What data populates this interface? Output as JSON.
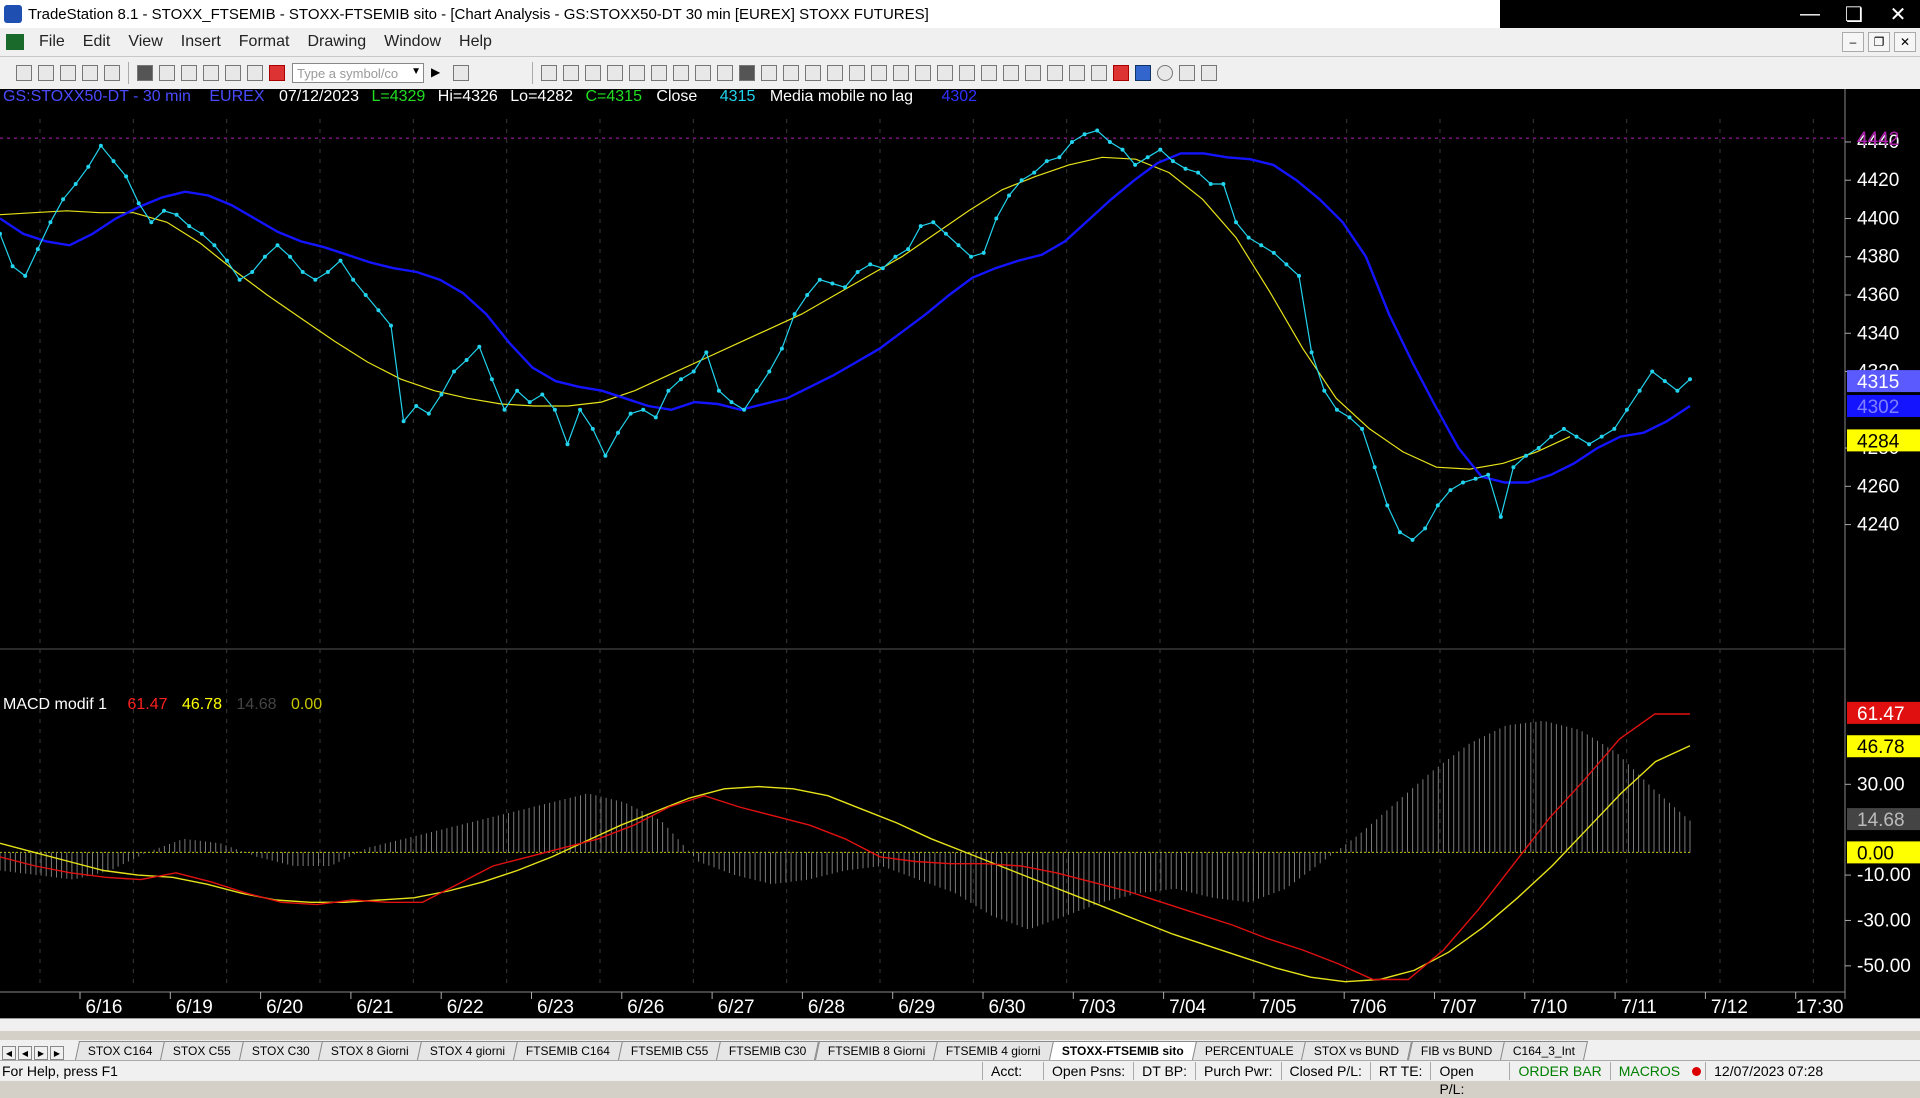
{
  "window": {
    "title": "TradeStation 8.1 - STOXX_FTSEMIB - STOXX-FTSEMIB sito - [Chart Analysis - GS:STOXX50-DT  30 min  [EUREX] STOXX FUTURES]"
  },
  "menu": {
    "items": [
      "File",
      "Edit",
      "View",
      "Insert",
      "Format",
      "Drawing",
      "Window",
      "Help"
    ]
  },
  "toolbar": {
    "symbol_placeholder": "Type a symbol/co"
  },
  "header": {
    "symbol": "GS:STOXX50-DT - 30 min",
    "exchange": "EUREX",
    "date": "07/12/2023",
    "last": "L=4329",
    "high": "Hi=4326",
    "low": "Lo=4282",
    "close": "C=4315",
    "close_label": "Close",
    "close_value": "4315",
    "ma_name": "Media mobile no lag",
    "ma_value": "4302"
  },
  "macd_header": {
    "name": "MACD modif 1",
    "v1": "61.47",
    "v2": "46.78",
    "v3": "14.68",
    "v4": "0.00"
  },
  "colors": {
    "price": "#22d3ee",
    "ma_blue": "#1414ff",
    "ma_yellow": "#e6e21a",
    "macd_red": "#e01010",
    "macd_yellow": "#e6e21a",
    "hist": "#7a7a7a",
    "marker_purple": "#b020b0"
  },
  "chart_data": [
    {
      "type": "line",
      "title": "GS:STOXX50-DT - 30 min",
      "x_labels": [
        "6/16",
        "6/19",
        "6/20",
        "6/21",
        "6/22",
        "6/23",
        "6/26",
        "6/27",
        "6/28",
        "6/29",
        "6/30",
        "7/03",
        "7/04",
        "7/05",
        "7/06",
        "7/07",
        "7/10",
        "7/11",
        "7/12",
        "17:30"
      ],
      "y_ticks": [
        "4440",
        "4420",
        "4400",
        "4380",
        "4360",
        "4340",
        "4320",
        "4280",
        "4260",
        "4240"
      ],
      "ylim": [
        4222,
        4452
      ],
      "price_tags": [
        {
          "value": 4442,
          "label": "4442",
          "color": "#b020b0"
        },
        {
          "value": 4315,
          "label": "4315",
          "color": "#5a5aff"
        },
        {
          "value": 4302,
          "label": "4302",
          "color": "#1414ff"
        },
        {
          "value": 4284,
          "label": "4284",
          "color": "#ffff00"
        }
      ],
      "series": [
        {
          "name": "Close",
          "values": [
            4392,
            4375,
            4370,
            4384,
            4398,
            4410,
            4418,
            4427,
            4438,
            4430,
            4422,
            4408,
            4398,
            4404,
            4402,
            4396,
            4392,
            4386,
            4378,
            4368,
            4372,
            4380,
            4386,
            4380,
            4372,
            4368,
            4372,
            4378,
            4368,
            4360,
            4352,
            4344,
            4294,
            4302,
            4298,
            4308,
            4320,
            4326,
            4333,
            4316,
            4300,
            4310,
            4304,
            4308,
            4300,
            4282,
            4300,
            4290,
            4276,
            4288,
            4298,
            4300,
            4296,
            4310,
            4316,
            4320,
            4330,
            4310,
            4304,
            4300,
            4310,
            4320,
            4332,
            4350,
            4360,
            4368,
            4366,
            4364,
            4372,
            4376,
            4374,
            4380,
            4384,
            4396,
            4398,
            4392,
            4386,
            4380,
            4382,
            4400,
            4412,
            4420,
            4424,
            4430,
            4432,
            4440,
            4444,
            4446,
            4440,
            4436,
            4428,
            4432,
            4436,
            4430,
            4426,
            4424,
            4418,
            4418,
            4398,
            4390,
            4386,
            4382,
            4376,
            4370,
            4330,
            4310,
            4300,
            4296,
            4290,
            4270,
            4250,
            4236,
            4232,
            4238,
            4250,
            4258,
            4262,
            4264,
            4266,
            4244,
            4270,
            4276,
            4280,
            4286,
            4290,
            4286,
            4282,
            4286,
            4290,
            4300,
            4310,
            4320,
            4315,
            4310,
            4316
          ]
        },
        {
          "name": "Media mobile no lag",
          "values": [
            4400,
            4392,
            4388,
            4386,
            4392,
            4400,
            4406,
            4411,
            4414,
            4412,
            4407,
            4400,
            4393,
            4388,
            4385,
            4381,
            4377,
            4374,
            4372,
            4368,
            4361,
            4350,
            4335,
            4322,
            4315,
            4312,
            4310,
            4306,
            4302,
            4300,
            4304,
            4303,
            4300,
            4303,
            4306,
            4312,
            4318,
            4325,
            4332,
            4341,
            4350,
            4360,
            4369,
            4374,
            4378,
            4381,
            4388,
            4399,
            4410,
            4420,
            4429,
            4434,
            4434,
            4432,
            4431,
            4428,
            4420,
            4410,
            4398,
            4380,
            4350,
            4325,
            4302,
            4280,
            4265,
            4262,
            4262,
            4266,
            4272,
            4280,
            4286,
            4288,
            4294,
            4302
          ]
        },
        {
          "name": "",
          "values": [
            4402,
            4403,
            4404,
            4403,
            4403,
            4398,
            4387,
            4373,
            4360,
            4348,
            4336,
            4325,
            4316,
            4310,
            4306,
            4303,
            4302,
            4302,
            4304,
            4310,
            4318,
            4326,
            4334,
            4342,
            4350,
            4360,
            4370,
            4380,
            4392,
            4404,
            4415,
            4422,
            4428,
            4432,
            4431,
            4424,
            4410,
            4390,
            4362,
            4332,
            4306,
            4290,
            4278,
            4270,
            4269,
            4272,
            4278,
            4286
          ]
        }
      ]
    },
    {
      "type": "line",
      "title": "MACD modif 1",
      "y_ticks": [
        "30.00",
        "-10.00",
        "-30.00",
        "-50.00"
      ],
      "ylim": [
        -58,
        72
      ],
      "value_tags": [
        {
          "value": 61.47,
          "label": "61.47",
          "color": "#e01010"
        },
        {
          "value": 46.78,
          "label": "46.78",
          "color": "#ffff00"
        },
        {
          "value": 14.68,
          "label": "14.68",
          "color": "#444444"
        },
        {
          "value": 0.0,
          "label": "0.00",
          "color": "#ffff00"
        }
      ],
      "series": [
        {
          "name": "",
          "values": [
            -2,
            -6,
            -9,
            -11,
            -12,
            -9,
            -13,
            -18,
            -22,
            -23,
            -21,
            -22,
            -22,
            -14,
            -6,
            -2,
            2,
            6,
            12,
            20,
            25,
            20,
            16,
            12,
            6,
            -2,
            -4,
            -5,
            -5,
            -6,
            -9,
            -13,
            -17,
            -22,
            -27,
            -32,
            -38,
            -43,
            -49,
            -56,
            -56,
            -43,
            -25,
            -5,
            15,
            32,
            50,
            61,
            61
          ]
        },
        {
          "name": "",
          "values": [
            4,
            0,
            -4,
            -8,
            -10,
            -11,
            -14,
            -18,
            -21,
            -22,
            -22,
            -21,
            -20,
            -17,
            -13,
            -8,
            -2,
            5,
            12,
            18,
            24,
            28,
            29,
            28,
            25,
            19,
            13,
            6,
            0,
            -6,
            -12,
            -18,
            -24,
            -30,
            -36,
            -41,
            -46,
            -51,
            -55,
            -57,
            -56,
            -52,
            -44,
            -33,
            -20,
            -6,
            10,
            26,
            40,
            47
          ]
        },
        {
          "name": "",
          "values": [
            -8,
            -10,
            -12,
            -8,
            0,
            6,
            4,
            -2,
            -6,
            -6,
            2,
            6,
            10,
            14,
            18,
            22,
            26,
            22,
            14,
            -4,
            -10,
            -14,
            -12,
            -8,
            -6,
            -12,
            -18,
            -28,
            -34,
            -28,
            -22,
            -18,
            -16,
            -20,
            -22,
            -16,
            -4,
            8,
            22,
            36,
            48,
            56,
            58,
            54,
            44,
            28,
            14
          ]
        }
      ]
    }
  ],
  "tabs": {
    "items": [
      "STOX C164",
      "STOX C55",
      "STOX  C30",
      "STOX  8 Giorni",
      "STOX 4 giorni",
      "FTSEMIB C164",
      "FTSEMIB C55",
      "FTSEMIB C30",
      "FTSEMIB  8 Giorni",
      "FTSEMIB  4 giorni",
      "STOXX-FTSEMIB sito",
      "PERCENTUALE",
      "STOX vs BUND",
      "FIB vs BUND",
      "C164_3_Int"
    ],
    "active": "STOXX-FTSEMIB sito"
  },
  "status": {
    "help": "For Help, press F1",
    "acct": "Acct:",
    "open_psns": "Open Psns:",
    "dt_bp": "DT BP:",
    "purch_pwr": "Purch Pwr:",
    "closed_pl": "Closed P/L:",
    "rt_te": "RT TE:",
    "open_pl": "Open P/L:",
    "order_bar": "ORDER BAR",
    "macros": "MACROS",
    "datetime": "12/07/2023 07:28"
  }
}
